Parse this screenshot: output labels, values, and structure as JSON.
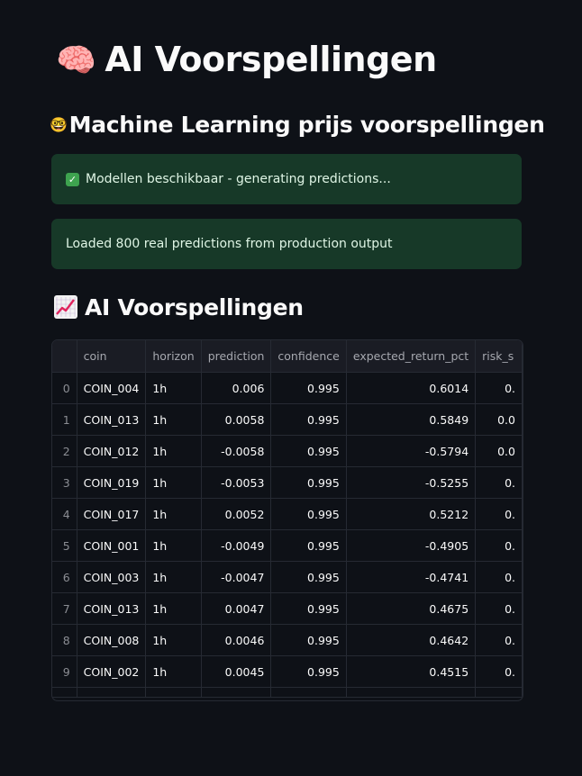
{
  "page": {
    "title": "AI Voorspellingen",
    "title_icon": "brain-emoji",
    "subtitle": "Machine Learning prijs voorspellingen",
    "subtitle_icon": "nerd-face-emoji",
    "success_alert": "Modellen beschikbaar - generating predictions...",
    "info_alert": "Loaded 800 real predictions from production output",
    "section_title": "AI Voorspellingen",
    "section_icon": "chart-increasing-emoji"
  },
  "table": {
    "columns": [
      "",
      "coin",
      "horizon",
      "prediction",
      "confidence",
      "expected_return_pct",
      "risk_s"
    ],
    "rows": [
      {
        "idx": "0",
        "coin": "COIN_004",
        "horizon": "1h",
        "prediction": "0.006",
        "confidence": "0.995",
        "ret": "0.6014",
        "risk": "0."
      },
      {
        "idx": "1",
        "coin": "COIN_013",
        "horizon": "1h",
        "prediction": "0.0058",
        "confidence": "0.995",
        "ret": "0.5849",
        "risk": "0.0"
      },
      {
        "idx": "2",
        "coin": "COIN_012",
        "horizon": "1h",
        "prediction": "-0.0058",
        "confidence": "0.995",
        "ret": "-0.5794",
        "risk": "0.0"
      },
      {
        "idx": "3",
        "coin": "COIN_019",
        "horizon": "1h",
        "prediction": "-0.0053",
        "confidence": "0.995",
        "ret": "-0.5255",
        "risk": "0."
      },
      {
        "idx": "4",
        "coin": "COIN_017",
        "horizon": "1h",
        "prediction": "0.0052",
        "confidence": "0.995",
        "ret": "0.5212",
        "risk": "0."
      },
      {
        "idx": "5",
        "coin": "COIN_001",
        "horizon": "1h",
        "prediction": "-0.0049",
        "confidence": "0.995",
        "ret": "-0.4905",
        "risk": "0."
      },
      {
        "idx": "6",
        "coin": "COIN_003",
        "horizon": "1h",
        "prediction": "-0.0047",
        "confidence": "0.995",
        "ret": "-0.4741",
        "risk": "0."
      },
      {
        "idx": "7",
        "coin": "COIN_013",
        "horizon": "1h",
        "prediction": "0.0047",
        "confidence": "0.995",
        "ret": "0.4675",
        "risk": "0."
      },
      {
        "idx": "8",
        "coin": "COIN_008",
        "horizon": "1h",
        "prediction": "0.0046",
        "confidence": "0.995",
        "ret": "0.4642",
        "risk": "0."
      },
      {
        "idx": "9",
        "coin": "COIN_002",
        "horizon": "1h",
        "prediction": "0.0045",
        "confidence": "0.995",
        "ret": "0.4515",
        "risk": "0."
      }
    ]
  }
}
